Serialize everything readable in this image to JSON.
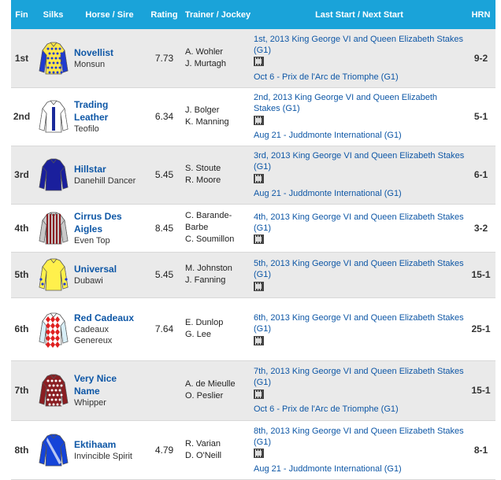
{
  "header": {
    "fin": "Fin",
    "silks": "Silks",
    "horse": "Horse / Sire",
    "rating": "Rating",
    "trainer": "Trainer / Jockey",
    "last_next": "Last Start / Next Start",
    "hrn": "HRN"
  },
  "rows": [
    {
      "fin": "1st",
      "silk": "yellow-spots",
      "horse": "Novellist",
      "sire": "Monsun",
      "rating": "7.73",
      "trainer": "A. Wohler",
      "jockey": "J. Murtagh",
      "last": "1st, 2013 King George VI and Queen Elizabeth Stakes (G1)",
      "next": "Oct 6 - Prix de l'Arc de Triomphe (G1)",
      "hrn": "9-2"
    },
    {
      "fin": "2nd",
      "silk": "white-blue-checks",
      "horse": "Trading Leather",
      "sire": "Teofilo",
      "rating": "6.34",
      "trainer": "J. Bolger",
      "jockey": "K. Manning",
      "last": "2nd, 2013 King George VI and Queen Elizabeth Stakes (G1)",
      "next": "Aug 21 - Juddmonte International (G1)",
      "hrn": "5-1"
    },
    {
      "fin": "3rd",
      "silk": "navy",
      "horse": "Hillstar",
      "sire": "Danehill Dancer",
      "rating": "5.45",
      "trainer": "S. Stoute",
      "jockey": "R. Moore",
      "last": "3rd, 2013 King George VI and Queen Elizabeth Stakes (G1)",
      "next": "Aug 21 - Juddmonte International (G1)",
      "hrn": "6-1"
    },
    {
      "fin": "4th",
      "silk": "grey-maroon-stripes",
      "horse": "Cirrus Des Aigles",
      "sire": "Even Top",
      "rating": "8.45",
      "trainer": "C. Barande-Barbe",
      "jockey": "C. Soumillon",
      "last": "4th, 2013 King George VI and Queen Elizabeth Stakes (G1)",
      "next": "",
      "hrn": "3-2"
    },
    {
      "fin": "5th",
      "silk": "yellow-blue",
      "horse": "Universal",
      "sire": "Dubawi",
      "rating": "5.45",
      "trainer": "M. Johnston",
      "jockey": "J. Fanning",
      "last": "5th, 2013 King George VI and Queen Elizabeth Stakes (G1)",
      "next": "",
      "hrn": "15-1"
    },
    {
      "fin": "6th",
      "silk": "red-diamonds",
      "horse": "Red Cadeaux",
      "sire": "Cadeaux Genereux",
      "rating": "7.64",
      "trainer": "E. Dunlop",
      "jockey": "G. Lee",
      "last": "6th, 2013 King George VI and Queen Elizabeth Stakes (G1)",
      "next": "",
      "hrn": "25-1"
    },
    {
      "fin": "7th",
      "silk": "maroon-spots",
      "horse": "Very Nice Name",
      "sire": "Whipper",
      "rating": "",
      "trainer": "A. de Mieulle",
      "jockey": "O. Peslier",
      "last": "7th, 2013 King George VI and Queen Elizabeth Stakes (G1)",
      "next": "Oct 6 - Prix de l'Arc de Triomphe (G1)",
      "hrn": "15-1"
    },
    {
      "fin": "8th",
      "silk": "royal-blue",
      "horse": "Ektihaam",
      "sire": "Invincible Spirit",
      "rating": "4.79",
      "trainer": "R. Varian",
      "jockey": "D. O'Neill",
      "last": "8th, 2013 King George VI and Queen Elizabeth Stakes (G1)",
      "next": "Aug 21 - Juddmonte International (G1)",
      "hrn": "8-1"
    }
  ],
  "colors": {
    "header_bg": "#1aa3d9",
    "link": "#0e57a6",
    "row_alt": "#eaeaea"
  }
}
